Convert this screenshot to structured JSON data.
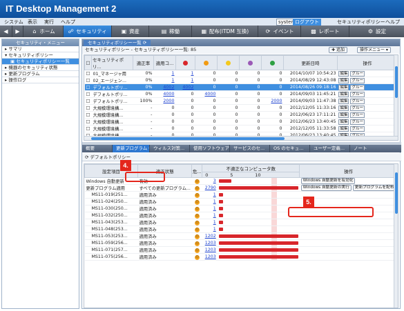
{
  "app": {
    "title": "IT Desktop Management 2"
  },
  "menu": {
    "items": [
      "システム",
      "表示",
      "実行",
      "ヘルプ"
    ],
    "user": "system",
    "logout": "ログアウト",
    "policy": "セキュリティポリシー",
    "help": "ヘルプ"
  },
  "toolbar": {
    "items": [
      {
        "label": "ホーム",
        "icon": "home-icon"
      },
      {
        "label": "セキュリティ",
        "icon": "shield-icon",
        "active": true
      },
      {
        "label": "資産",
        "icon": "asset-icon"
      },
      {
        "label": "稼働",
        "icon": "activity-icon"
      },
      {
        "label": "配布(ITDM 互換)",
        "icon": "distribution-icon"
      },
      {
        "label": "イベント",
        "icon": "event-icon"
      },
      {
        "label": "レポート",
        "icon": "report-icon"
      },
      {
        "label": "設定",
        "icon": "gear-icon"
      }
    ]
  },
  "sidebar": {
    "header": "セキュリティ・メニュー",
    "items": [
      {
        "label": "サマリ",
        "level": 0
      },
      {
        "label": "セキュリティポリシー",
        "level": 0
      },
      {
        "label": "セキュリティポリシー一覧",
        "level": 1,
        "selected": true
      },
      {
        "label": "機器のセキュリティ状態",
        "level": 0
      },
      {
        "label": "更新プログラム",
        "level": 0
      },
      {
        "label": "操作ログ",
        "level": 0
      }
    ]
  },
  "main": {
    "tab": "セキュリティポリシー一覧",
    "breadcrumb": "セキュリティポリシー - セキュリティポリシー一覧: 85",
    "add_button": "追加",
    "ops_button": "操作メニュー",
    "columns": [
      "セキュリティポリ...",
      "適正率",
      "適用コ...",
      "",
      "",
      "",
      "",
      "",
      "更新日時",
      "操作"
    ],
    "rows": [
      {
        "name": "01_マネージャ用",
        "rate": "0%",
        "c1": "1",
        "c2": "1",
        "c3": "0",
        "c4": "0",
        "c5": "0",
        "c6": "0",
        "date": "2014/10/07 10:54:23"
      },
      {
        "name": "02_エージェン...",
        "rate": "0%",
        "c1": "1",
        "c2": "1",
        "c3": "0",
        "c4": "0",
        "c5": "0",
        "c6": "0",
        "date": "2014/08/29 12:43:08"
      },
      {
        "name": "デフォルトポリ...",
        "rate": "0%",
        "c1": "4002",
        "c2": "4002",
        "c3": "0",
        "c4": "0",
        "c5": "0",
        "c6": "0",
        "date": "2014/08/26 09:18:16",
        "selected": true
      },
      {
        "name": "デフォルトポリ...",
        "rate": "0%",
        "c1": "4000",
        "c2": "0",
        "c3": "4000",
        "c4": "0",
        "c5": "0",
        "c6": "0",
        "date": "2014/09/03 11:45:21"
      },
      {
        "name": "デフォルトポリ...",
        "rate": "100%",
        "c1": "2000",
        "c2": "0",
        "c3": "0",
        "c4": "0",
        "c5": "0",
        "c6": "2000",
        "date": "2014/09/03 11:47:38"
      },
      {
        "name": "大規模環境構...",
        "rate": "-",
        "c1": "0",
        "c2": "0",
        "c3": "0",
        "c4": "0",
        "c5": "0",
        "c6": "0",
        "date": "2012/12/05 11:33:16"
      },
      {
        "name": "大規模環境構...",
        "rate": "-",
        "c1": "0",
        "c2": "0",
        "c3": "0",
        "c4": "0",
        "c5": "0",
        "c6": "0",
        "date": "2012/06/23 17:11:21"
      },
      {
        "name": "大規模環境構...",
        "rate": "-",
        "c1": "0",
        "c2": "0",
        "c3": "0",
        "c4": "0",
        "c5": "0",
        "c6": "0",
        "date": "2012/06/23 13:40:45"
      },
      {
        "name": "大規模環境構...",
        "rate": "-",
        "c1": "0",
        "c2": "0",
        "c3": "0",
        "c4": "0",
        "c5": "0",
        "c6": "0",
        "date": "2012/12/05 11:33:58"
      },
      {
        "name": "大規模環境構...",
        "rate": "-",
        "c1": "0",
        "c2": "0",
        "c3": "0",
        "c4": "0",
        "c5": "0",
        "c6": "0",
        "date": "2012/06/23 13:40:45"
      },
      {
        "name": "大規模環境構...",
        "rate": "-",
        "c1": "0",
        "c2": "0",
        "c3": "0",
        "c4": "0",
        "c5": "0",
        "c6": "0",
        "date": "2012/06/23 13:40:45"
      },
      {
        "name": "大規模環境構...",
        "rate": "-",
        "c1": "0",
        "c2": "0",
        "c3": "0",
        "c4": "0",
        "c5": "0",
        "c6": "0",
        "date": "2012/06/23 13:40:45"
      }
    ],
    "row_button_edit": "編集",
    "row_button_group": "グルー"
  },
  "bottom": {
    "tabs": [
      "概要",
      "更新プログラム",
      "ウィルス対策...",
      "使用ソフトウェア",
      "サービスのセ...",
      "OS のセキュ...",
      "ユーザー定義...",
      "ノート"
    ],
    "active_tab": 1,
    "policy_label": "デフォルトポリシー",
    "columns": {
      "item": "設定項目",
      "status": "適正状態",
      "risk": "危...",
      "noncompliant": "不適正なコンピュータ数",
      "ops": "操作"
    },
    "axis_ticks": [
      "0",
      "5",
      "10"
    ],
    "rows": [
      {
        "item": "Windows 自動更新",
        "status": "有効",
        "count": "3",
        "value": 3
      },
      {
        "item": "更新プログラム適用",
        "status": "すべての更新プログラム...",
        "count": "2790",
        "value": 2790
      },
      {
        "item": "MS11-019(251...",
        "status": "適用済み",
        "count": "1",
        "value": 1
      },
      {
        "item": "MS11-024(250...",
        "status": "適用済み",
        "count": "1",
        "value": 1
      },
      {
        "item": "MS11-030(250...",
        "status": "適用済み",
        "count": "1",
        "value": 1
      },
      {
        "item": "MS11-032(250...",
        "status": "適用済み",
        "count": "1",
        "value": 1
      },
      {
        "item": "MS11-043(253...",
        "status": "適用済み",
        "count": "1",
        "value": 1
      },
      {
        "item": "MS11-048(253...",
        "status": "適用済み",
        "count": "1",
        "value": 1
      },
      {
        "item": "MS11-053(253...",
        "status": "適用済み",
        "count": "1202",
        "value": 1202
      },
      {
        "item": "MS11-059(256...",
        "status": "適用済み",
        "count": "1203",
        "value": 1203
      },
      {
        "item": "MS11-071(257...",
        "status": "適用済み",
        "count": "1203",
        "value": 1203
      },
      {
        "item": "MS11-075(256...",
        "status": "適用済み",
        "count": "1203",
        "value": 1203
      }
    ],
    "op_enable_auto_update": "Windows 自動更新を有効化",
    "op_run_update": "Windows 自動更新の実行",
    "op_distribute": "更新プログラムを配布"
  },
  "callouts": [
    "4.",
    "5."
  ],
  "colors": {
    "accent": "#3f8fe0",
    "title_bar": "#1c6bbd",
    "bar_red": "#d8262b",
    "callout_red": "#e4261c"
  }
}
